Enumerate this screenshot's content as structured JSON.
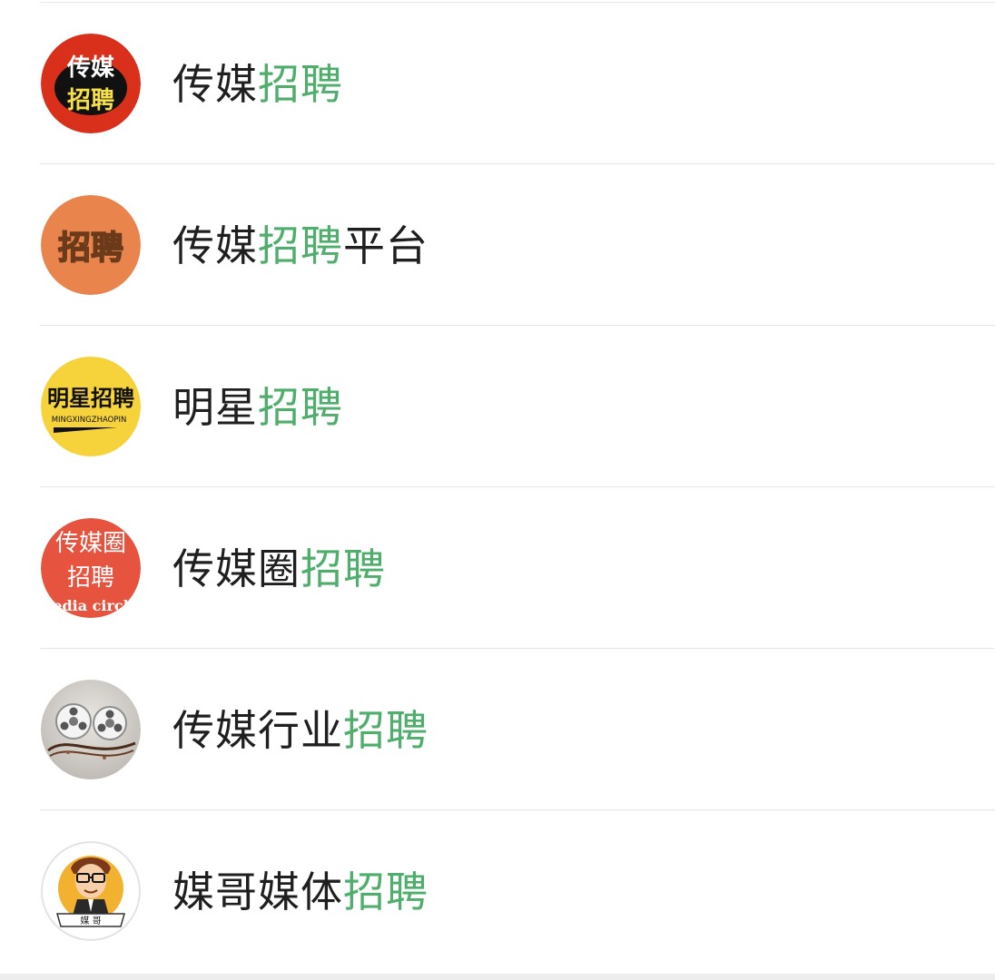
{
  "results": [
    {
      "avatar_icon": "chuanmei-zhaopin-logo-icon",
      "avatar_color": "#d9301c",
      "avatar_text": [
        "传媒",
        "招聘"
      ],
      "title_parts": [
        {
          "text": "传媒",
          "highlight": false
        },
        {
          "text": "招聘",
          "highlight": true
        }
      ]
    },
    {
      "avatar_icon": "zhaopin-badge-icon",
      "avatar_color": "#e8844c",
      "avatar_text": [
        "招聘"
      ],
      "title_parts": [
        {
          "text": "传媒",
          "highlight": false
        },
        {
          "text": "招聘",
          "highlight": true
        },
        {
          "text": "平台",
          "highlight": false
        }
      ]
    },
    {
      "avatar_icon": "mingxing-zhaopin-logo-icon",
      "avatar_color": "#f6d33a",
      "avatar_text": [
        "明星招聘",
        "MINGXINGZHAOPIN"
      ],
      "title_parts": [
        {
          "text": "明星",
          "highlight": false
        },
        {
          "text": "招聘",
          "highlight": true
        }
      ]
    },
    {
      "avatar_icon": "media-circle-logo-icon",
      "avatar_color": "#e6533e",
      "avatar_text": [
        "传媒圈",
        "招聘",
        "edia circl"
      ],
      "title_parts": [
        {
          "text": "传媒圈",
          "highlight": false
        },
        {
          "text": "招聘",
          "highlight": true
        }
      ]
    },
    {
      "avatar_icon": "film-reel-photo-icon",
      "avatar_color": "#c8c4bf",
      "avatar_text": [],
      "title_parts": [
        {
          "text": "传媒行业",
          "highlight": false
        },
        {
          "text": "招聘",
          "highlight": true
        }
      ]
    },
    {
      "avatar_icon": "cartoon-man-avatar-icon",
      "avatar_color": "#f2b230",
      "avatar_text": [
        "媒 哥"
      ],
      "title_parts": [
        {
          "text": "媒哥媒体",
          "highlight": false
        },
        {
          "text": "招聘",
          "highlight": true
        }
      ]
    }
  ],
  "colors": {
    "highlight": "#4fae6b",
    "text": "#1f1f1f",
    "divider": "#e6e6e6"
  }
}
